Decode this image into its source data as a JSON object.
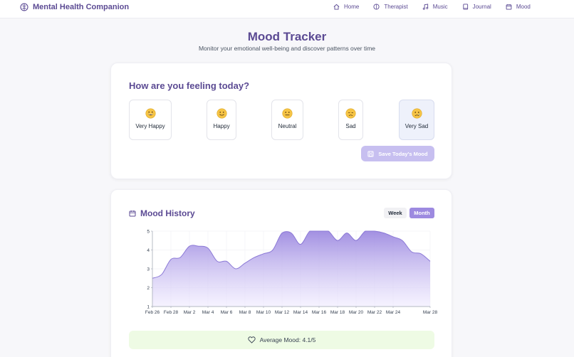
{
  "nav": {
    "brand": "Mental Health Companion",
    "items": [
      {
        "label": "Home",
        "icon": "home-icon"
      },
      {
        "label": "Therapist",
        "icon": "brain-icon"
      },
      {
        "label": "Music",
        "icon": "music-note-icon"
      },
      {
        "label": "Journal",
        "icon": "book-icon"
      },
      {
        "label": "Mood",
        "icon": "calendar-icon"
      }
    ]
  },
  "header": {
    "title": "Mood Tracker",
    "subtitle": "Monitor your emotional well-being and discover patterns over time"
  },
  "mood_picker": {
    "question": "How are you feeling today?",
    "options": [
      {
        "label": "Very Happy",
        "emoji": "grinning-face"
      },
      {
        "label": "Happy",
        "emoji": "slightly-smiling-face"
      },
      {
        "label": "Neutral",
        "emoji": "neutral-face"
      },
      {
        "label": "Sad",
        "emoji": "pensive-face"
      },
      {
        "label": "Very Sad",
        "emoji": "crying-face"
      }
    ],
    "selected": "Very Sad",
    "save_label": "Save Today's Mood"
  },
  "history": {
    "title": "Mood History",
    "toggle_week": "Week",
    "toggle_month": "Month",
    "active_toggle": "Month",
    "average_label": "Average Mood: 4.1/5"
  },
  "chart_data": {
    "type": "area",
    "x": [
      "Feb 26",
      "Feb 27",
      "Feb 28",
      "Mar 1",
      "Mar 2",
      "Mar 3",
      "Mar 4",
      "Mar 5",
      "Mar 6",
      "Mar 7",
      "Mar 8",
      "Mar 9",
      "Mar 10",
      "Mar 11",
      "Mar 12",
      "Mar 13",
      "Mar 14",
      "Mar 15",
      "Mar 16",
      "Mar 17",
      "Mar 18",
      "Mar 19",
      "Mar 20",
      "Mar 21",
      "Mar 22",
      "Mar 23",
      "Mar 24",
      "Mar 25",
      "Mar 26",
      "Mar 27",
      "Mar 28"
    ],
    "tick_labels": [
      "Feb 26",
      "Feb 28",
      "Mar 2",
      "Mar 4",
      "Mar 6",
      "Mar 8",
      "Mar 10",
      "Mar 12",
      "Mar 14",
      "Mar 16",
      "Mar 18",
      "Mar 20",
      "Mar 22",
      "Mar 24",
      "Mar 28"
    ],
    "series": [
      {
        "values": [
          2.5,
          2.7,
          3.5,
          3.6,
          4.2,
          4.2,
          4.1,
          3.4,
          3.4,
          3.0,
          3.3,
          3.6,
          3.8,
          4.0,
          4.9,
          4.9,
          4.3,
          5.0,
          5.0,
          5.0,
          4.5,
          4.9,
          4.5,
          5.0,
          5.0,
          4.9,
          4.7,
          4.5,
          3.9,
          3.8,
          3.4
        ]
      }
    ],
    "ylim": [
      1,
      5
    ],
    "yticks": [
      1,
      2,
      3,
      4,
      5
    ],
    "grid": true,
    "fill_color_top": "#9d8ae0",
    "fill_color_bottom": "#efeaff",
    "line_color": "#8b79d6"
  },
  "colors": {
    "brand": "#5b4a93",
    "accent": "#9d8ae0",
    "save_disabled": "#c7bff0",
    "average_bg": "#eefbe4"
  }
}
